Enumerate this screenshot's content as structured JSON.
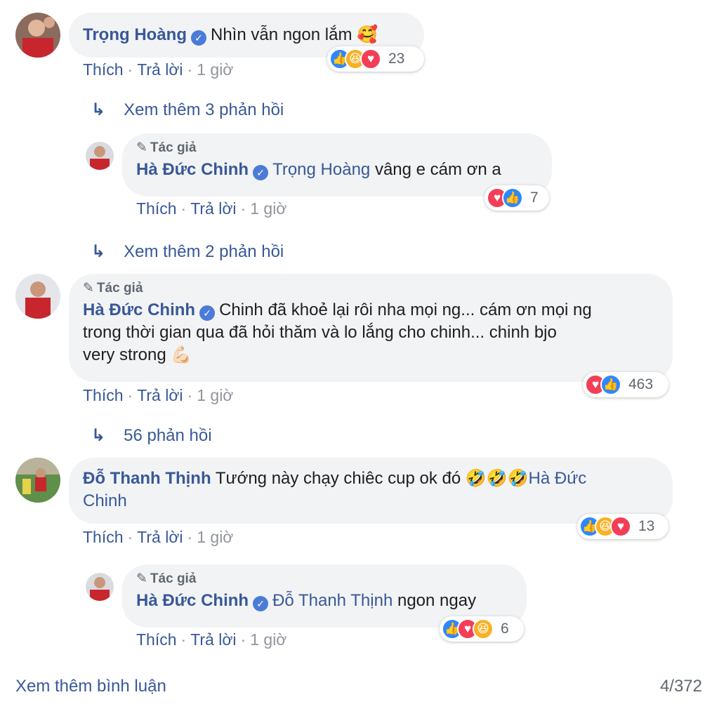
{
  "comments": [
    {
      "name": "Trọng Hoàng",
      "text": "Nhìn vẫn ngon lắm",
      "emoji": "🥰",
      "actions": {
        "like": "Thích",
        "reply": "Trả lời",
        "time": "1 giờ"
      },
      "reaction_count": "23",
      "more_replies": "Xem thêm 3 phản hồi",
      "reply": {
        "author_tag": "Tác giả",
        "name": "Hà Đức Chinh",
        "mention": "Trọng Hoàng",
        "text": "vâng e cám ơn a",
        "actions": {
          "like": "Thích",
          "reply": "Trả lời",
          "time": "1 giờ"
        },
        "reaction_count": "7"
      }
    },
    {
      "more_replies_before": "Xem thêm 2 phản hồi",
      "author_tag": "Tác giả",
      "name": "Hà Đức Chinh",
      "text_line1": "Chinh đã khoẻ lại rôi nha mọi ng... cám ơn mọi ng",
      "text_line2": "trong thời gian qua đã hỏi thăm và lo lắng cho chinh... chinh bjo",
      "text_line3": "very strong",
      "emoji": "💪🏻",
      "actions": {
        "like": "Thích",
        "reply": "Trả lời",
        "time": "1 giờ"
      },
      "reaction_count": "463",
      "replies_label": "56 phản hồi"
    },
    {
      "name": "Đỗ Thanh Thịnh",
      "text": "Tướng này chạy chiêc cup ok đó",
      "emoji": "🤣🤣🤣",
      "mention_line1": "Hà Đức",
      "mention_line2": "Chinh",
      "actions": {
        "like": "Thích",
        "reply": "Trả lời",
        "time": "1 giờ"
      },
      "reaction_count": "13",
      "reply": {
        "author_tag": "Tác giả",
        "name": "Hà Đức Chinh",
        "mention": "Đỗ Thanh Thịnh",
        "text": "ngon ngay",
        "actions": {
          "like": "Thích",
          "reply": "Trả lời",
          "time": "1 giờ"
        },
        "reaction_count": "6"
      }
    }
  ],
  "footer": {
    "view_more": "Xem thêm bình luận",
    "count": "4/372"
  },
  "icons": {
    "like": "like-icon",
    "love": "love-icon",
    "haha": "haha-icon",
    "pencil": "pencil-icon",
    "reply_arrow": "reply-arrow-icon",
    "verified": "verified-badge-icon"
  },
  "colors": {
    "link": "#385898",
    "bubble": "#f2f3f5",
    "like": "#2d88ff",
    "love": "#f33e58",
    "haha": "#f7b125"
  }
}
